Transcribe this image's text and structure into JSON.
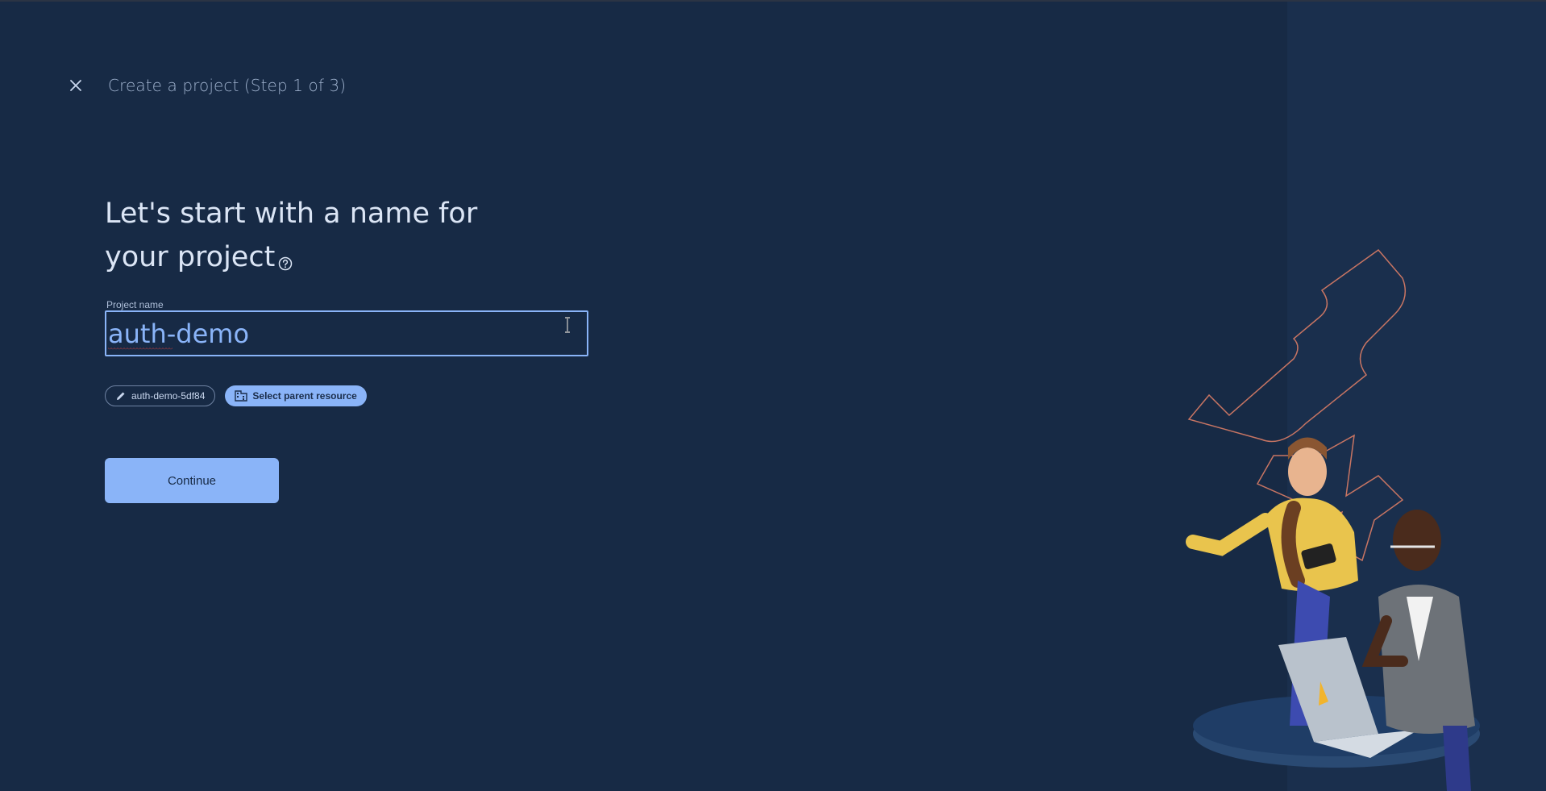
{
  "header": {
    "title": "Create a project (Step 1 of 3)",
    "close_icon": "close-icon"
  },
  "main": {
    "heading_line1": "Let's start with a name for",
    "heading_line2": "your project",
    "help_icon": "help-circle-icon",
    "field_label": "Project name",
    "project_name_value": "auth-demo",
    "project_id_chip": "auth-demo-5df84",
    "project_id_icon": "pencil-icon",
    "parent_resource_chip": "Select parent resource",
    "parent_resource_icon": "building-icon",
    "continue_label": "Continue"
  },
  "colors": {
    "background": "#172a45",
    "accent": "#8ab4f8",
    "illustration_outline": "#c87563"
  }
}
